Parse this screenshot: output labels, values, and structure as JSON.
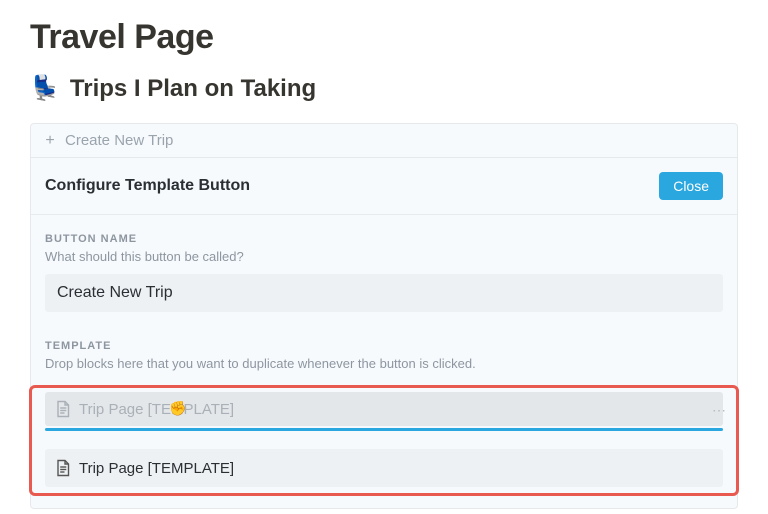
{
  "page": {
    "title": "Travel Page"
  },
  "section": {
    "emoji": "💺",
    "heading": "Trips I Plan on Taking"
  },
  "button_block": {
    "create_label": "Create New Trip",
    "config_title": "Configure Template Button",
    "close_label": "Close",
    "name_section": {
      "label": "BUTTON NAME",
      "hint": "What should this button be called?",
      "value": "Create New Trip"
    },
    "template_section": {
      "label": "TEMPLATE",
      "hint": "Drop blocks here that you want to duplicate whenever the button is clicked.",
      "ghost_item": "Trip Page [TEMPLATE]",
      "dragged_item": "Trip Page [TEMPLATE]"
    }
  }
}
